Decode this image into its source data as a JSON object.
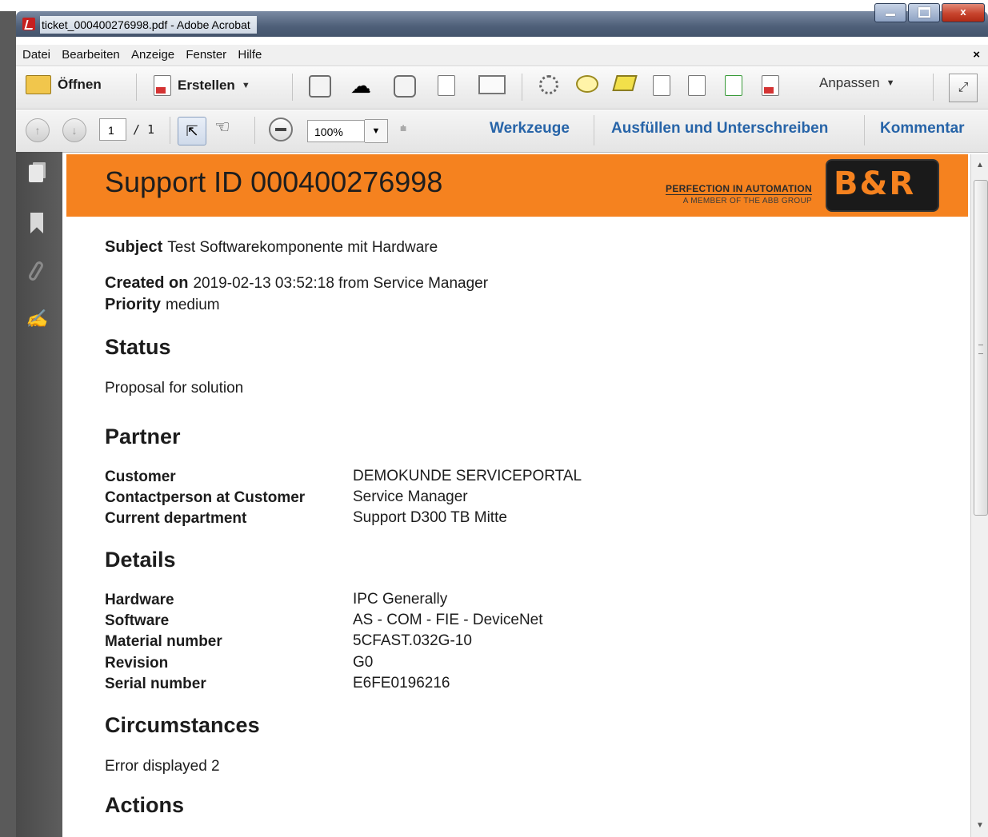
{
  "window": {
    "title": "ticket_000400276998.pdf - Adobe Acrobat",
    "close_glyph": "x"
  },
  "menu": {
    "items": [
      "Datei",
      "Bearbeiten",
      "Anzeige",
      "Fenster",
      "Hilfe"
    ],
    "close_glyph": "×"
  },
  "toolbar": {
    "open_label": "Öffnen",
    "create_label": "Erstellen",
    "customize_label": "Anpassen"
  },
  "nav": {
    "page_current": "1",
    "page_total": "/ 1",
    "zoom": "100%",
    "tools_label": "Werkzeuge",
    "fill_sign_label": "Ausfüllen und Unterschreiben",
    "comment_label": "Kommentar"
  },
  "document": {
    "title": "Support ID 000400276998",
    "tagline": "PERFECTION IN AUTOMATION",
    "tagline_sub": "A MEMBER OF THE ABB GROUP",
    "logo_text": "B&R",
    "subject_label": "Subject",
    "subject_value": "Test Softwarekomponente mit Hardware",
    "created_label": "Created on",
    "created_value": "2019-02-13 03:52:18 from Service Manager",
    "priority_label": "Priority",
    "priority_value": "medium",
    "status_heading": "Status",
    "status_value": "Proposal for solution",
    "partner_heading": "Partner",
    "partner": [
      {
        "key": "Customer",
        "value": "DEMOKUNDE SERVICEPORTAL"
      },
      {
        "key": "Contactperson at Customer",
        "value": "Service Manager"
      },
      {
        "key": "Current department",
        "value": "Support D300 TB Mitte"
      }
    ],
    "details_heading": "Details",
    "details": [
      {
        "key": "Hardware",
        "value": "IPC Generally"
      },
      {
        "key": "Software",
        "value": "AS - COM - FIE - DeviceNet"
      },
      {
        "key": "Material number",
        "value": "5CFAST.032G-10"
      },
      {
        "key": "Revision",
        "value": "G0"
      },
      {
        "key": "Serial number",
        "value": "E6FE0196216"
      }
    ],
    "circumstances_heading": "Circumstances",
    "circumstances_value": "Error displayed 2",
    "actions_heading": "Actions"
  },
  "colors": {
    "header_orange": "#f5821f",
    "link_blue": "#2764a8"
  }
}
